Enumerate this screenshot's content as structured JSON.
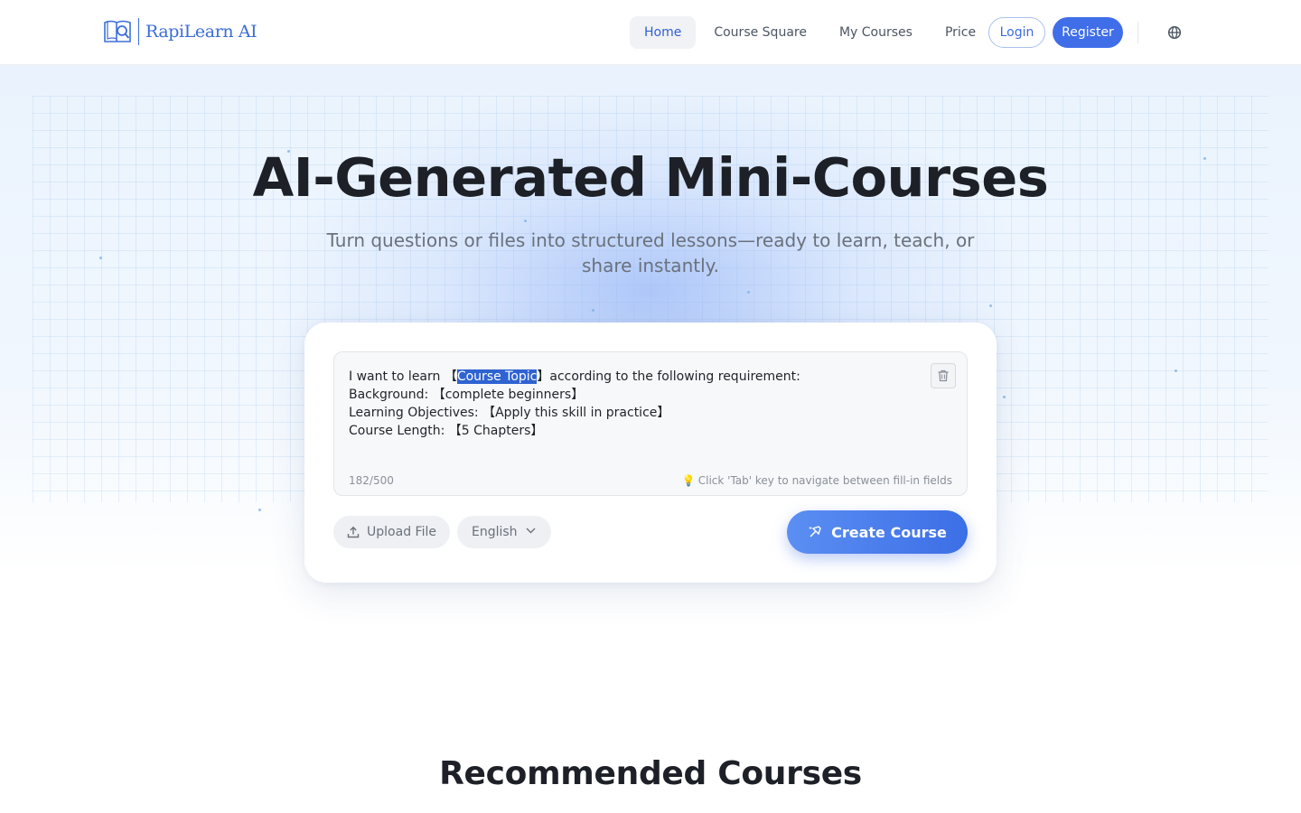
{
  "brand": {
    "name": "RapiLearn AI",
    "logo_icon": "book-magnifier-icon",
    "accent": "#3f6ee8"
  },
  "nav": {
    "items": [
      {
        "label": "Home",
        "active": true
      },
      {
        "label": "Course Square",
        "active": false
      },
      {
        "label": "My Courses",
        "active": false
      },
      {
        "label": "Price",
        "active": false
      }
    ],
    "login_label": "Login",
    "register_label": "Register",
    "language_icon": "globe-icon"
  },
  "hero": {
    "title": "AI-Generated Mini-Courses",
    "subtitle": "Turn questions or files into structured lessons—ready to learn, teach, or share instantly."
  },
  "composer": {
    "prompt": {
      "line1_before": "I want to learn 【",
      "line1_selected": "Course Topic",
      "line1_after": "】according to the following requirement:",
      "line2": "Background: 【complete beginners】",
      "line3": "Learning Objectives: 【Apply this skill in practice】",
      "line4": "Course Length: 【5 Chapters】"
    },
    "char_count": "182/500",
    "hint": "Click 'Tab' key to navigate between fill-in fields",
    "hint_icon": "lightbulb-icon",
    "clear_icon": "trash-icon",
    "upload_label": "Upload File",
    "language_value": "English",
    "create_label": "Create Course"
  },
  "recommended": {
    "title": "Recommended Courses"
  }
}
